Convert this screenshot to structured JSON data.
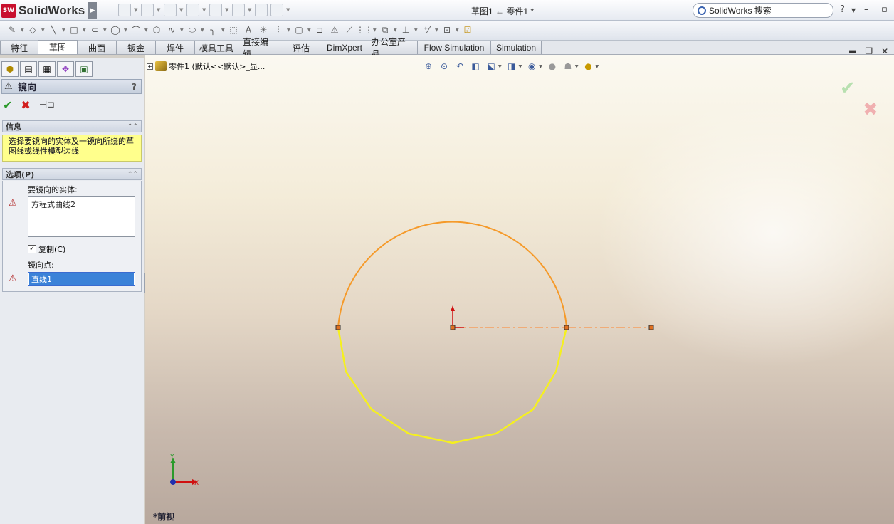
{
  "app": {
    "brand_prefix": "SW",
    "brand": "SolidWorks"
  },
  "window": {
    "title": "草图1 ← 零件1 *"
  },
  "search": {
    "text": "SolidWorks 搜索"
  },
  "tabs": [
    {
      "label": "特征",
      "w": 54
    },
    {
      "label": "草图",
      "w": 56,
      "active": true
    },
    {
      "label": "曲面",
      "w": 56
    },
    {
      "label": "钣金",
      "w": 56
    },
    {
      "label": "焊件",
      "w": 56
    },
    {
      "label": "模具工具",
      "w": 62
    },
    {
      "label": "直接编辑",
      "w": 60
    },
    {
      "label": "评估",
      "w": 60
    },
    {
      "label": "DimXpert",
      "w": 64
    },
    {
      "label": "办公室产品",
      "w": 72
    },
    {
      "label": "Flow Simulation",
      "w": 104
    },
    {
      "label": "Simulation",
      "w": 72
    }
  ],
  "property_manager": {
    "title": "镜向",
    "help": "?",
    "info_group": {
      "label": "信息",
      "message": "选择要镜向的实体及一镜向所绕的草图线或线性模型边线"
    },
    "options_group": {
      "label": "选项(P)",
      "entities_label": "要镜向的实体:",
      "entities": [
        "方程式曲线2"
      ],
      "copy_label": "复制(C)",
      "copy_checked": true,
      "mirror_point_label": "镜向点:",
      "mirror_point_value": "直线1"
    }
  },
  "graphics": {
    "tree_item": "零件1  (默认<<默认>_显...",
    "view_name": "*前视",
    "triad_x": "X",
    "triad_y": "Y",
    "colors": {
      "arc": "#f59a2a",
      "mirrored_curve": "#f5f01e",
      "centerline": "#f5a060",
      "point": "#e07020"
    }
  },
  "icons": {
    "ok": "check-icon",
    "cancel": "x-icon",
    "pin": "pushpin-icon"
  }
}
